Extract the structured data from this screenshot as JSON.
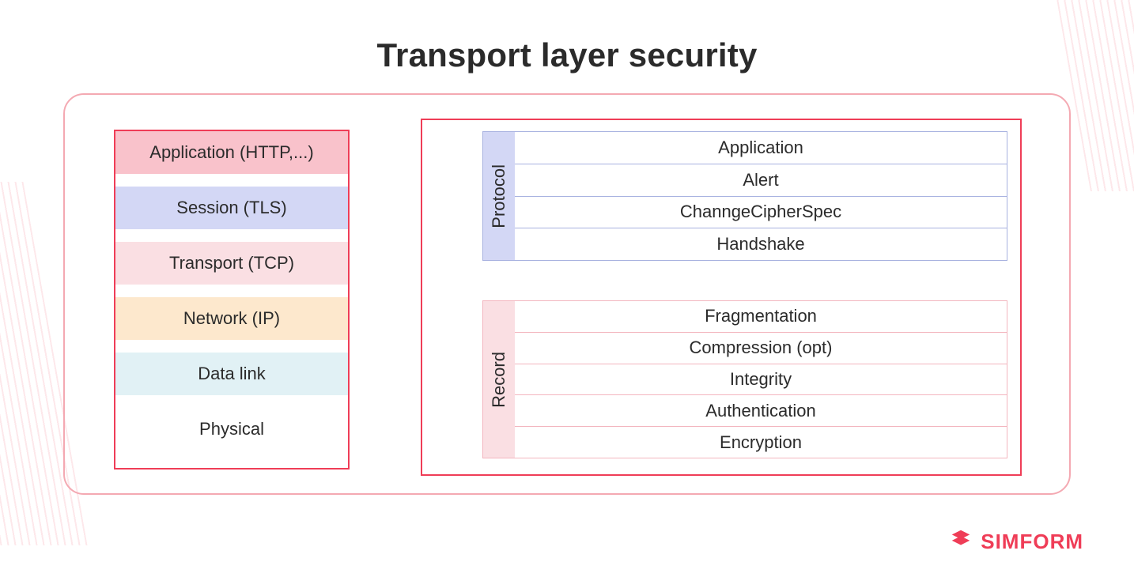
{
  "title": "Transport layer security",
  "layers": {
    "application": "Application (HTTP,...)",
    "session": "Session (TLS)",
    "transport": "Transport (TCP)",
    "network": "Network (IP)",
    "datalink": "Data link",
    "physical": "Physical"
  },
  "protocol": {
    "label": "Protocol",
    "rows": {
      "application": "Application",
      "alert": "Alert",
      "change_cipher": "ChanngeCipherSpec",
      "handshake": "Handshake"
    }
  },
  "record": {
    "label": "Record",
    "rows": {
      "fragmentation": "Fragmentation",
      "compression": "Compression (opt)",
      "integrity": "Integrity",
      "authentication": "Authentication",
      "encryption": "Encryption"
    }
  },
  "brand": "SIMFORM",
  "colors": {
    "accent": "#ef3d57",
    "accent_soft": "#f4a9b2",
    "pink": "#f9c2cb",
    "violet": "#d3d7f5",
    "salmon": "#fadfe3",
    "peach": "#fde8cd",
    "ice": "#e1f1f5"
  }
}
